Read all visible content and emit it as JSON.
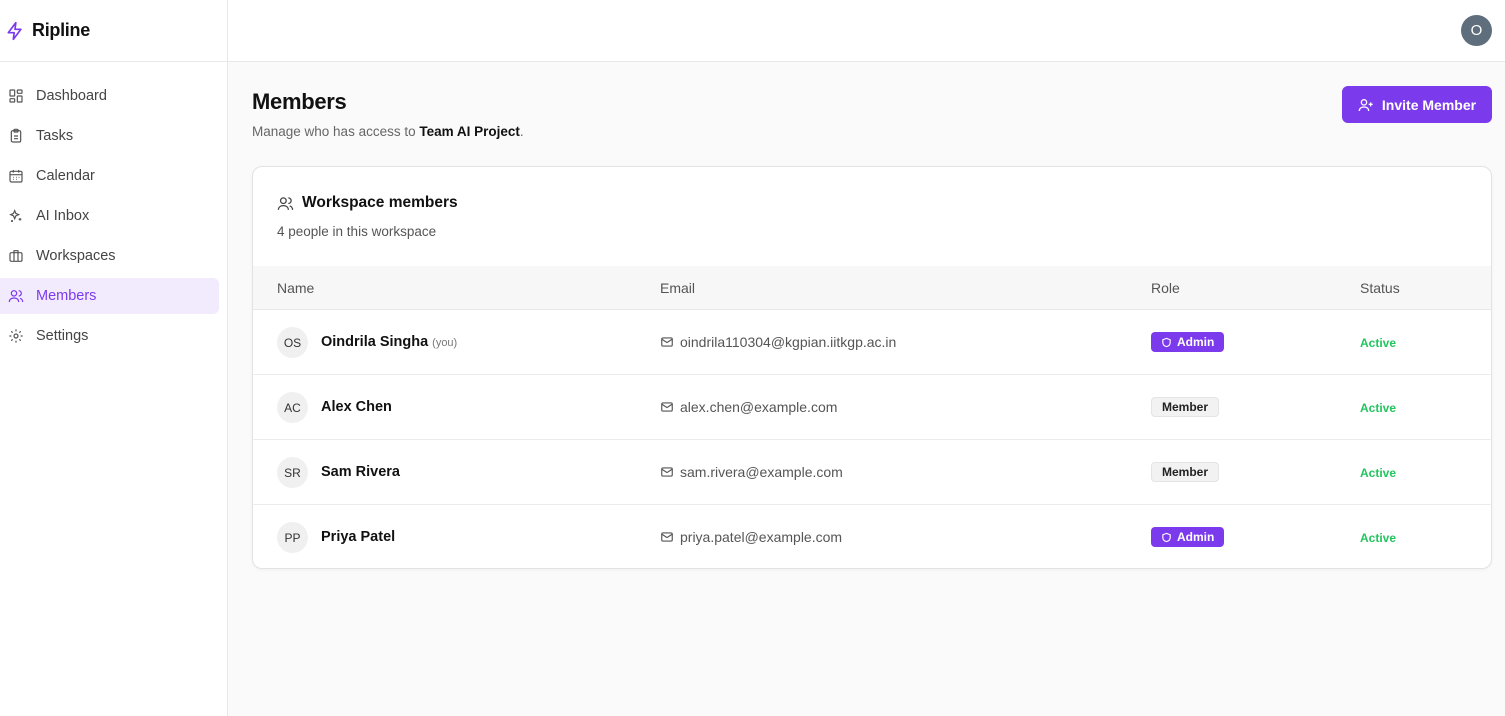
{
  "app": {
    "name": "Ripline",
    "user_initial": "O"
  },
  "sidebar": {
    "items": [
      {
        "label": "Dashboard",
        "icon": "grid-icon",
        "active": false
      },
      {
        "label": "Tasks",
        "icon": "clipboard-icon",
        "active": false
      },
      {
        "label": "Calendar",
        "icon": "calendar-icon",
        "active": false
      },
      {
        "label": "AI Inbox",
        "icon": "sparkles-icon",
        "active": false
      },
      {
        "label": "Workspaces",
        "icon": "briefcase-icon",
        "active": false
      },
      {
        "label": "Members",
        "icon": "users-icon",
        "active": true
      },
      {
        "label": "Settings",
        "icon": "gear-icon",
        "active": false
      }
    ]
  },
  "page": {
    "title": "Members",
    "subtitle_prefix": "Manage who has access to ",
    "project": "Team AI Project",
    "subtitle_suffix": ".",
    "invite_label": "Invite Member"
  },
  "card": {
    "title": "Workspace members",
    "subtitle": "4 people in this workspace",
    "columns": {
      "name": "Name",
      "email": "Email",
      "role": "Role",
      "status": "Status"
    }
  },
  "members": [
    {
      "initials": "OS",
      "name": "Oindrila Singha",
      "you_label": "(you)",
      "email": "oindrila110304@kgpian.iitkgp.ac.in",
      "role": "Admin",
      "status": "Active"
    },
    {
      "initials": "AC",
      "name": "Alex Chen",
      "you_label": "",
      "email": "alex.chen@example.com",
      "role": "Member",
      "status": "Active"
    },
    {
      "initials": "SR",
      "name": "Sam Rivera",
      "you_label": "",
      "email": "sam.rivera@example.com",
      "role": "Member",
      "status": "Active"
    },
    {
      "initials": "PP",
      "name": "Priya Patel",
      "you_label": "",
      "email": "priya.patel@example.com",
      "role": "Admin",
      "status": "Active"
    }
  ],
  "colors": {
    "accent": "#7c3aed",
    "active_status": "#22c55e",
    "active_nav_bg": "#f1ebfd"
  }
}
